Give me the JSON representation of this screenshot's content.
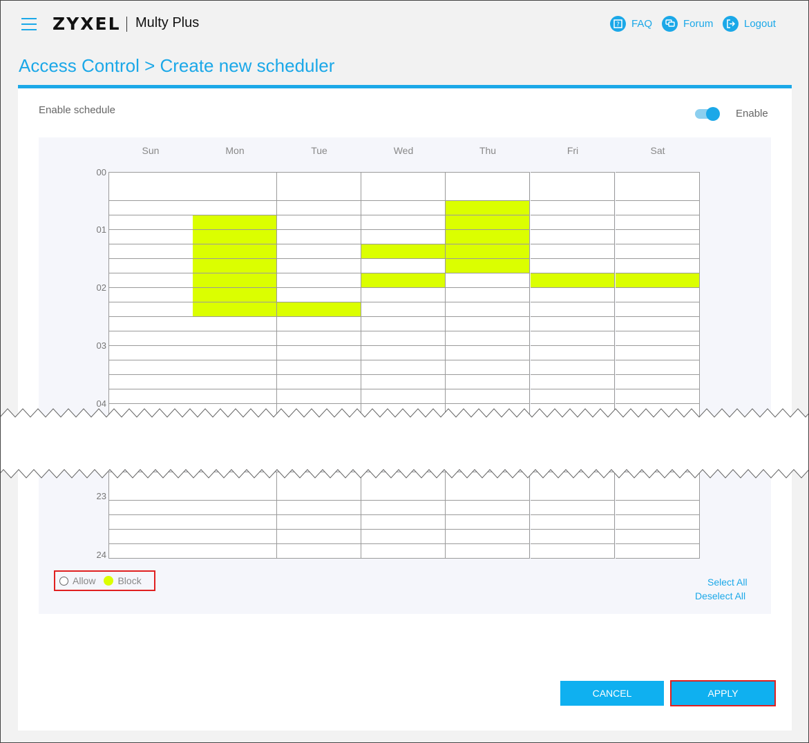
{
  "header": {
    "brand": "ZYXEL",
    "product": "Multy Plus",
    "links": [
      {
        "label": "FAQ",
        "icon": "faq-icon"
      },
      {
        "label": "Forum",
        "icon": "forum-icon"
      },
      {
        "label": "Logout",
        "icon": "logout-icon"
      }
    ]
  },
  "page_title": "Access Control > Create new scheduler",
  "schedule": {
    "enable_label": "Enable schedule",
    "toggle_state": "Enable",
    "toggle_on": true,
    "days": [
      "Sun",
      "Mon",
      "Tue",
      "Wed",
      "Thu",
      "Fri",
      "Sat"
    ],
    "hours_top": [
      "00",
      "01",
      "02",
      "03",
      "04"
    ],
    "hours_bottom": [
      "23",
      "24"
    ],
    "blocked_slots_15min": {
      "Mon": [
        3,
        4,
        5,
        6,
        7,
        8,
        9
      ],
      "Tue": [
        9
      ],
      "Wed": [
        5,
        7
      ],
      "Thu": [
        2,
        3,
        4,
        5,
        6
      ],
      "Fri": [
        7
      ],
      "Sat": [
        7
      ]
    }
  },
  "legend": {
    "allow": "Allow",
    "block": "Block",
    "block_color": "#dbff00"
  },
  "actions": {
    "select_all": "Select All",
    "deselect_all": "Deselect All"
  },
  "buttons": {
    "cancel": "CANCEL",
    "apply": "APPLY"
  },
  "colors": {
    "accent": "#1ba8e8",
    "block": "#dbff00",
    "highlight": "#e02020"
  }
}
